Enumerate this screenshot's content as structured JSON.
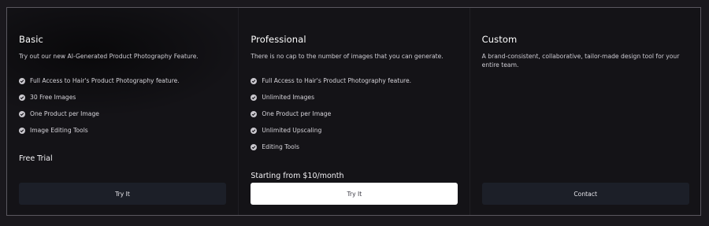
{
  "plans": [
    {
      "title": "Basic",
      "description": "Try out our new AI-Generated Product Photography Feature.",
      "features": [
        "Full Access to Hair's Product Photography feature.",
        "30 Free Images",
        "One Product per Image",
        "Image Editing Tools"
      ],
      "price_text": "Free Trial",
      "button_label": "Try It"
    },
    {
      "title": "Professional",
      "description": "There is no cap to the number of images that you can generate.",
      "features": [
        "Full Access to Hair's Product Photography feature.",
        "Unlimited Images",
        "One Product per Image",
        "Unlimited Upscaling",
        "Editing Tools"
      ],
      "price_text": "Starting from $10/month",
      "button_label": "Try It"
    },
    {
      "title": "Custom",
      "description": "A brand-consistent, collaborative, tailor-made design tool for your entire team.",
      "features": [],
      "price_text": "",
      "button_label": "Contact"
    }
  ],
  "colors": {
    "page_background": "#1a181d",
    "card_background": "#141317",
    "button_dark": "#1c1f28",
    "button_light": "#ffffff"
  }
}
